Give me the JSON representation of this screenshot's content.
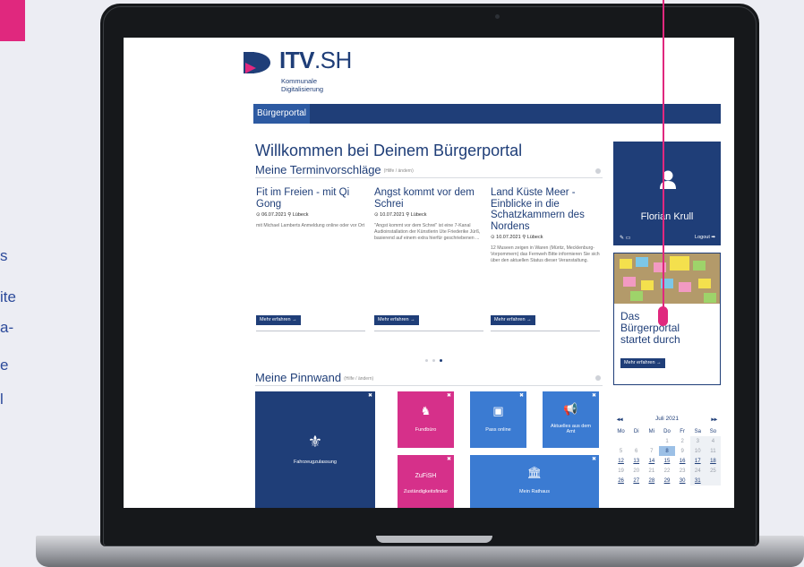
{
  "slide": {
    "side_text_lines": [
      "s",
      "ite",
      "a-",
      "e",
      "l"
    ]
  },
  "site": {
    "brand_name_bold": "ITV",
    "brand_name_light": ".SH",
    "brand_sub_1": "Kommunale",
    "brand_sub_2": "Digitalisierung",
    "nav_tab": "Bürgerportal",
    "welcome_title": "Willkommen bei Deinem Bürgerportal",
    "appointments": {
      "title": "Meine Terminvorschläge",
      "hint": "(Hilfe / ändern)",
      "cards": [
        {
          "title": "Fit im Freien - mit Qi Gong",
          "meta": "⊙ 06.07.2021 ⚲ Lübeck",
          "body": "mit Michael Lamberts Anmeldung online oder vor Ort",
          "button": "Mehr erfahren →"
        },
        {
          "title": "Angst kommt vor dem Schrei",
          "meta": "⊙ 10.07.2021 ⚲ Lübeck",
          "body": "\"Angst kommt vor dem Schrei\" ist eine 7-Kanal Audioinstallation der Künstlerin Ute Friederike Jürß, basierend auf einem extra hierfür geschriebenen ...",
          "button": "Mehr erfahren →"
        },
        {
          "title": "Land Küste Meer - Einblicke in die Schatzkammern des Nordens",
          "meta": "⊙ 10.07.2021 ⚲ Lübeck",
          "body": "12 Museen zeigen in Waren (Müritz, Mecklenburg-Vorpommern) das Fernweh Bitte informieren Sie sich über den aktuellen Status dieser Veranstaltung.",
          "button": "Mehr erfahren →"
        }
      ]
    },
    "pinboard": {
      "title": "Meine Pinnwand",
      "hint": "(Hilfe / ändern)",
      "tiles": [
        {
          "label": "Fahrzeugzulassung",
          "icon": "eagle-icon",
          "glyph": "⚜",
          "color": "#1f3e78"
        },
        {
          "label": "Fundbüro",
          "icon": "bag-icon",
          "glyph": "♞",
          "color": "#d6308a"
        },
        {
          "label": "Pass online",
          "icon": "id-card-icon",
          "glyph": "▣",
          "color": "#3b7bd2"
        },
        {
          "label": "Aktuelles aus dem Amt",
          "icon": "megaphone-icon",
          "glyph": "📢",
          "color": "#3b7bd2"
        },
        {
          "label": "Zuständigkeitsfinder",
          "icon": "text-icon",
          "glyph": "ZuFiSH",
          "color": "#d6308a"
        },
        {
          "label": "Mein Rathaus",
          "icon": "townhall-icon",
          "glyph": "🏛",
          "color": "#3b7bd2"
        }
      ]
    },
    "profile": {
      "name": "Florian Krull",
      "logout": "Logout ➡"
    },
    "news": {
      "title_1": "Das",
      "title_2": "Bürgerportal",
      "title_3": "startet durch",
      "button": "Mehr erfahren →"
    },
    "calendar": {
      "prev": "◂◂",
      "next": "▸▸",
      "month": "Juli 2021",
      "weekdays": [
        "Mo",
        "Di",
        "Mi",
        "Do",
        "Fr",
        "Sa",
        "So"
      ],
      "weeks": [
        [
          "",
          "",
          "",
          "1",
          "2",
          "3",
          "4"
        ],
        [
          "5",
          "6",
          "7",
          "8",
          "9",
          "10",
          "11"
        ],
        [
          "12",
          "13",
          "14",
          "15",
          "16",
          "17",
          "18"
        ],
        [
          "19",
          "20",
          "21",
          "22",
          "23",
          "24",
          "25"
        ],
        [
          "26",
          "27",
          "28",
          "29",
          "30",
          "31",
          ""
        ]
      ],
      "today": "8",
      "underlined": [
        "12",
        "13",
        "14",
        "15",
        "16",
        "17",
        "18",
        "26",
        "27",
        "28",
        "29",
        "30",
        "31"
      ]
    },
    "colors": {
      "brand_navy": "#1f3e78",
      "accent_pink": "#e0287e",
      "tile_magenta": "#d6308a",
      "tile_blue": "#3b7bd2"
    }
  }
}
